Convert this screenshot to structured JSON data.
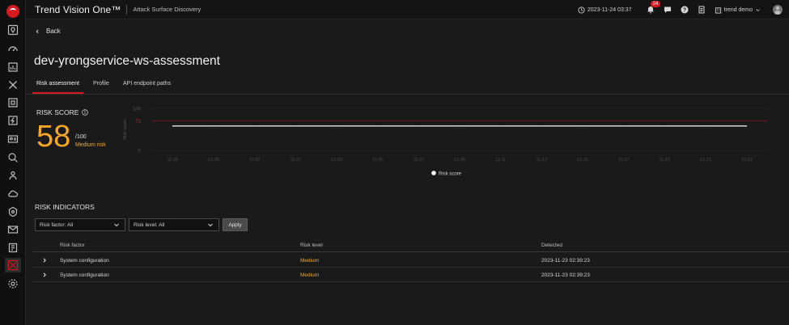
{
  "header": {
    "app_title": "Trend Vision One™",
    "module": "Attack Surface Discovery",
    "datetime": "2023-11-24 03:37",
    "notifications_count": "24",
    "user_name": "trend demo"
  },
  "nav": {
    "back_label": "Back"
  },
  "page": {
    "title": "dev-yrongservice-ws-assessment",
    "tabs": [
      {
        "label": "Risk assessment",
        "active": true
      },
      {
        "label": "Profile",
        "active": false
      },
      {
        "label": "API endpoint paths",
        "active": false
      }
    ]
  },
  "risk_score": {
    "label": "RISK SCORE",
    "value": "58",
    "max": "/100",
    "level": "Medium risk"
  },
  "chart_data": {
    "type": "line",
    "ylabel": "Risk score",
    "yticks": [
      "0",
      "70",
      "100"
    ],
    "ylim": [
      0,
      100
    ],
    "threshold": 70,
    "x": [
      "11-26",
      "11-28",
      "11-30",
      "11-01",
      "11-03",
      "11-05",
      "11-07",
      "11-09",
      "11-11",
      "11-13",
      "11-15",
      "11-17",
      "11-19",
      "11-21",
      "11-23"
    ],
    "series": [
      {
        "name": "Risk score",
        "values": [
          58,
          58,
          58,
          58,
          58,
          58,
          58,
          58,
          58,
          58,
          58,
          58,
          58,
          58,
          58
        ]
      }
    ],
    "legend": "bottom-center",
    "colors": {
      "line": "#e6e6e6",
      "threshold": "#8b1a1a"
    }
  },
  "risk_indicators": {
    "label": "RISK INDICATORS",
    "filters": {
      "risk_factor": "Risk factor: All",
      "risk_level": "Risk level: All",
      "apply_label": "Apply"
    },
    "columns": [
      "Risk factor",
      "Risk level",
      "Detected"
    ],
    "rows": [
      {
        "factor": "System configuration",
        "level": "Medium",
        "detected": "2023-11-23 02:39:23"
      },
      {
        "factor": "System configuration",
        "level": "Medium",
        "detected": "2023-11-23 02:39:23"
      }
    ]
  },
  "icons": {
    "rail": [
      "logo-icon",
      "map-pin-icon",
      "dashboard-icon",
      "report-icon",
      "close-x-icon",
      "document-icon",
      "lightning-icon",
      "contact-card-icon",
      "search-zoom-icon",
      "users-icon",
      "cloud-icon",
      "shield-icon",
      "mail-icon",
      "clipboard-icon",
      "attack-surface-icon",
      "gear-icon"
    ]
  },
  "colors": {
    "accent": "#d71920",
    "medium": "#f5a623"
  }
}
